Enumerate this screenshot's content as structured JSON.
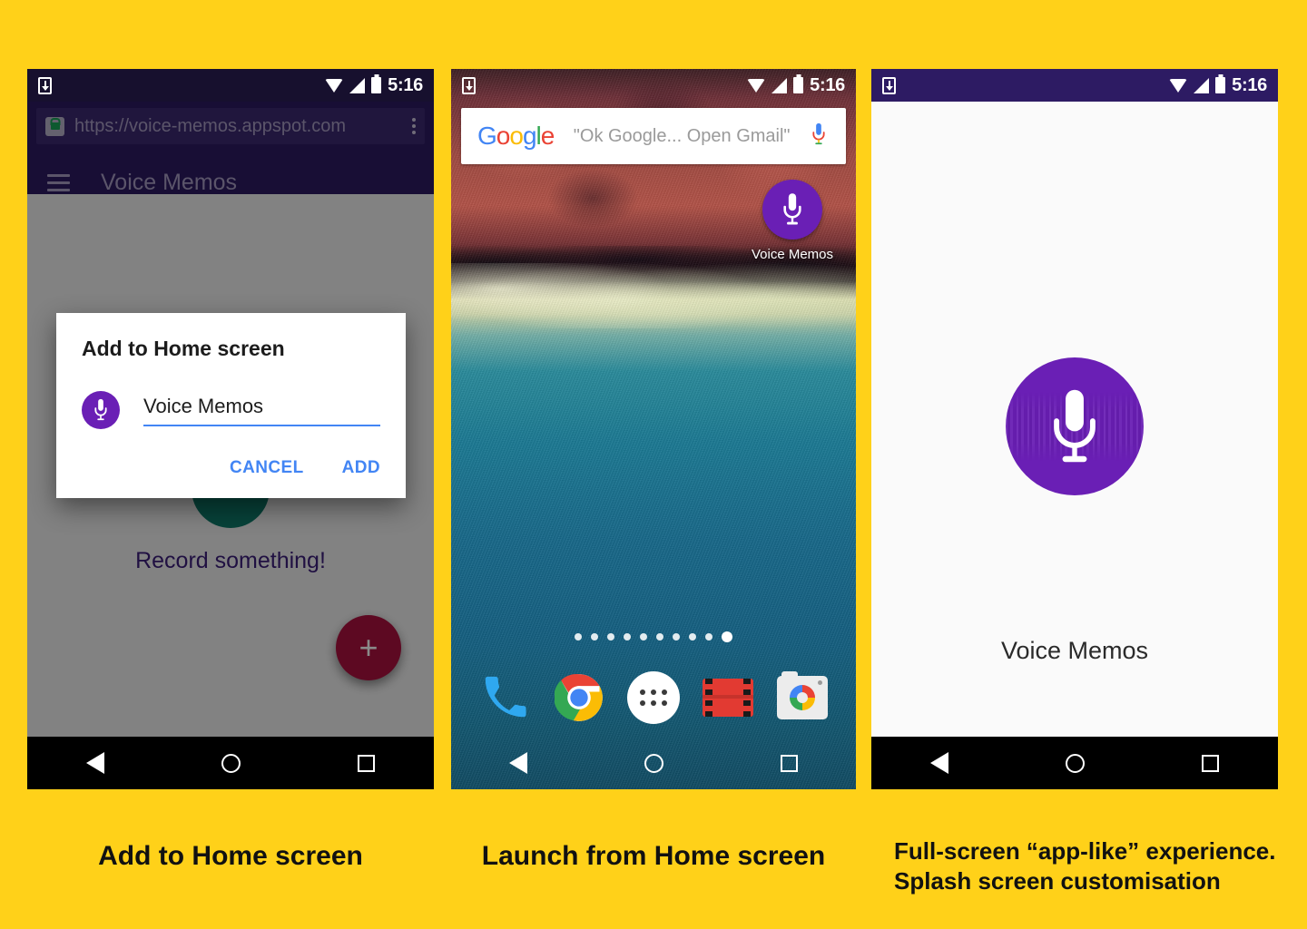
{
  "page": {
    "background_color": "#FFD119",
    "accent_purple": "#6a1fb5",
    "status_time": "5:16"
  },
  "phone1": {
    "name": "Add to Home screen dialog",
    "statusbar": {
      "time": "5:16",
      "download_icon": "download-icon",
      "wifi_icon": "wifi-icon",
      "signal_icon": "signal-icon",
      "battery_icon": "battery-icon"
    },
    "browser": {
      "url": "https://voice-memos.appspot.com",
      "lock_icon": "lock-icon",
      "overflow_icon": "kebab-menu-icon"
    },
    "appbar": {
      "menu_icon": "hamburger-icon",
      "title": "Voice Memos"
    },
    "content": {
      "empty_state_text": "Record something!",
      "fab_label": "+"
    },
    "dialog": {
      "title": "Add to Home screen",
      "icon": "microphone-icon",
      "input_value": "Voice Memos",
      "input_placeholder": "Voice Memos",
      "cancel_label": "CANCEL",
      "add_label": "ADD"
    },
    "navbar": {
      "back": "back-icon",
      "home": "home-icon",
      "recents": "recents-icon"
    }
  },
  "phone2": {
    "name": "Android home screen",
    "statusbar": {
      "time": "5:16"
    },
    "search": {
      "logo_letters": [
        "G",
        "o",
        "o",
        "g",
        "l",
        "e"
      ],
      "hint": "\"Ok Google... Open Gmail\"",
      "mic_icon": "mic-icon"
    },
    "shortcut": {
      "label": "Voice Memos",
      "icon": "microphone-icon"
    },
    "page_dots": {
      "count": 10,
      "active_index": 9
    },
    "dock": [
      {
        "name": "phone-app",
        "label": "Phone"
      },
      {
        "name": "chrome-app",
        "label": "Chrome"
      },
      {
        "name": "all-apps",
        "label": "All apps"
      },
      {
        "name": "play-movies-app",
        "label": "Play Movies"
      },
      {
        "name": "camera-app",
        "label": "Camera"
      }
    ]
  },
  "phone3": {
    "name": "App splash screen",
    "statusbar": {
      "time": "5:16"
    },
    "splash": {
      "icon": "microphone-icon",
      "app_name": "Voice Memos"
    }
  },
  "captions": {
    "one": "Add to Home screen",
    "two": "Launch from Home screen",
    "three_line1": "Full-screen “app-like” experience.",
    "three_line2": "Splash screen customisation"
  }
}
